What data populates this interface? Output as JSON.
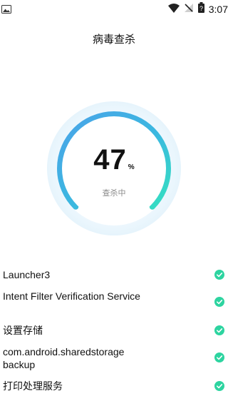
{
  "status_bar": {
    "time": "3:07",
    "icons": [
      "image-icon",
      "wifi-icon",
      "no-signal-icon",
      "battery-icon"
    ]
  },
  "header": {
    "title": "病毒查杀"
  },
  "scan": {
    "percent": "47",
    "percent_sign": "%",
    "progress": 0.47,
    "status": "查杀中",
    "colors": {
      "arc_start": "#4aa3e8",
      "arc_end": "#35e0c0",
      "ring_bg": "#e8f5fd"
    }
  },
  "items": [
    {
      "label": "Launcher3",
      "status": "check-icon"
    },
    {
      "label": "Intent Filter Verification Service",
      "status": "check-icon"
    },
    {
      "label": "设置存储",
      "status": "check-icon"
    },
    {
      "label": "com.android.sharedstorage backup",
      "status": "check-icon"
    },
    {
      "label": "打印处理服务",
      "status": "check-icon"
    }
  ],
  "accent_color": "#2dd4a0"
}
